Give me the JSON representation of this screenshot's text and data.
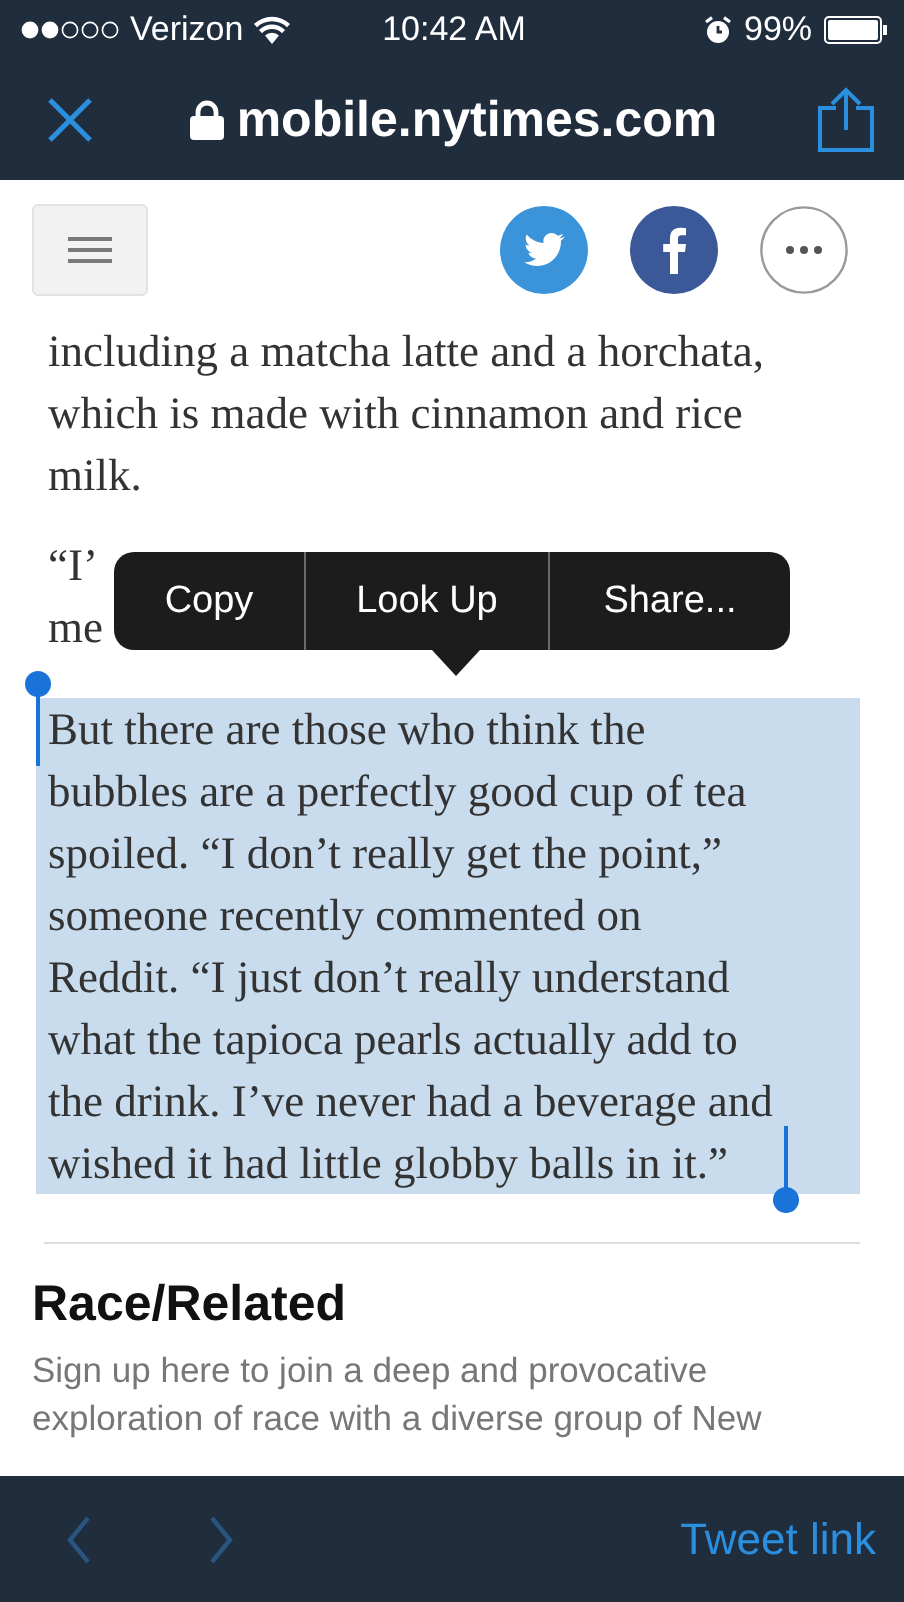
{
  "status_bar": {
    "carrier": "Verizon",
    "time": "10:42 AM",
    "battery": "99%"
  },
  "nav_bar": {
    "url": "mobile.nytimes.com"
  },
  "article": {
    "paragraphs": [
      {
        "lines": [
          "including a matcha latte and a horchata,",
          "which is made with cinnamon and rice",
          "milk."
        ],
        "selected": false
      },
      {
        "lines": [
          "“I’",
          "me"
        ],
        "selected": false
      },
      {
        "lines": [
          "But there are those who think the",
          "bubbles are a perfectly good cup of tea",
          "spoiled. “I don’t really get the point,”",
          "someone recently commented on",
          "Reddit. “I just don’t really understand",
          "what the tapioca pearls actually add to",
          "the drink. I’ve never had a beverage and",
          "wished it had little globby balls in it.”"
        ],
        "selected": true
      }
    ]
  },
  "context_menu": {
    "items": [
      "Copy",
      "Look Up",
      "Share..."
    ]
  },
  "section": {
    "heading": "Race/Related",
    "description_lines": [
      "Sign up here to join a deep and provocative",
      "exploration of race with a diverse group of New"
    ]
  },
  "bottom_bar": {
    "nav_buttons": [
      {
        "kind": "back",
        "disabled": true
      },
      {
        "kind": "forward",
        "disabled": true
      }
    ],
    "action": "Tweet link"
  }
}
